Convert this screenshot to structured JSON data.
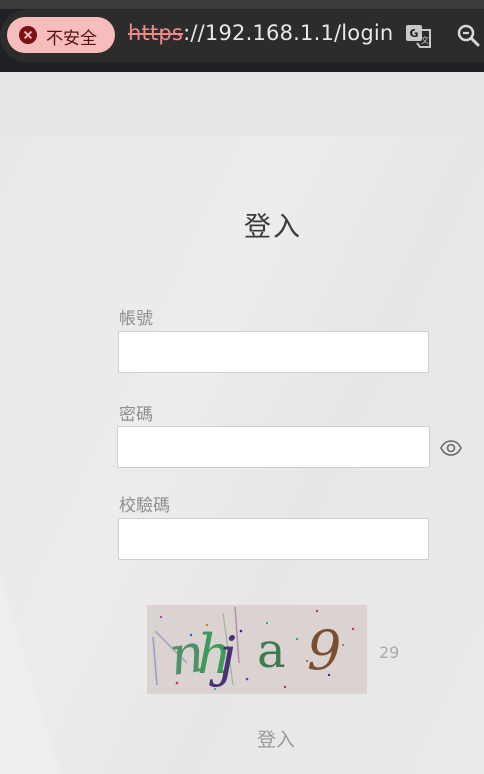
{
  "browser": {
    "security_label": "不安全",
    "url_scheme": "https",
    "url_rest": "://192.168.1.1/login",
    "colors": {
      "chip_bg": "#f7bcbc",
      "chip_icon": "#7a1212",
      "scheme_red": "#f08a8a"
    },
    "icons": [
      "not-secure-icon",
      "translate-icon",
      "zoom-icon"
    ]
  },
  "form": {
    "title": "登入",
    "username_label": "帳號",
    "username_value": "",
    "password_label": "密碼",
    "password_value": "",
    "captcha_label": "校驗碼",
    "captcha_value": "",
    "captcha_text": "nhja9",
    "captcha_countdown": "29",
    "submit_label": "登入"
  }
}
